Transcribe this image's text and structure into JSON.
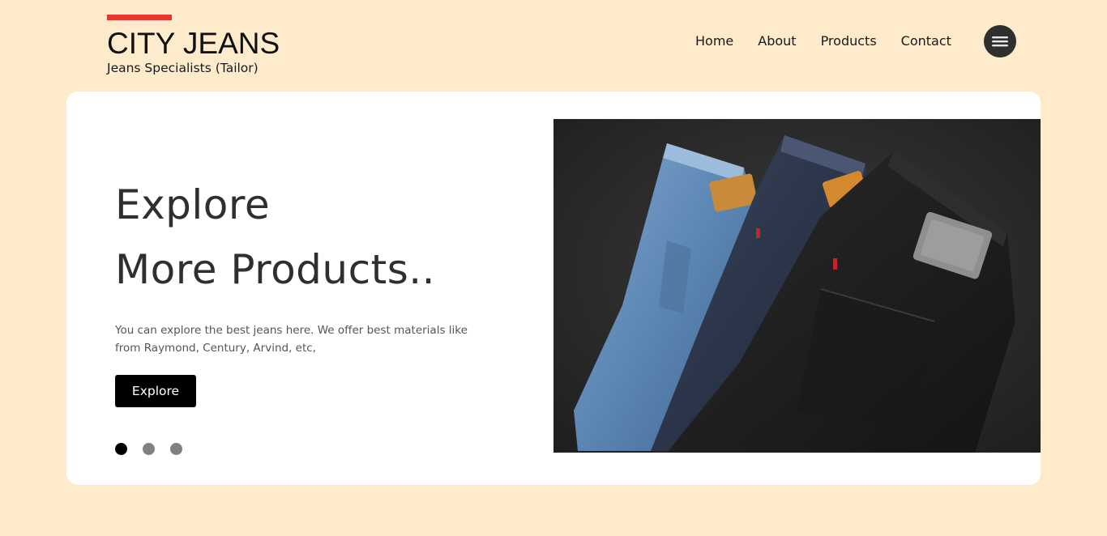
{
  "brand": {
    "title": "CITY JEANS",
    "subtitle": "Jeans Specialists (Tailor)",
    "accent_color": "#e8372e"
  },
  "nav": {
    "items": [
      {
        "label": "Home"
      },
      {
        "label": "About"
      },
      {
        "label": "Products"
      },
      {
        "label": "Contact"
      }
    ],
    "menu_icon": "hamburger-icon"
  },
  "hero": {
    "headline_line1": "Explore",
    "headline_line2": "More Products..",
    "description": "You can explore the best jeans here. We offer best materials like from Raymond, Century, Arvind, etc,",
    "button_label": "Explore",
    "slides": [
      {
        "active": true
      },
      {
        "active": false
      },
      {
        "active": false
      }
    ],
    "image_subject": "three pairs of folded jeans (light blue, dark blue, black) on dark background"
  },
  "colors": {
    "background": "#fdebcb",
    "card": "#ffffff",
    "button": "#000000",
    "dot_active": "#000000",
    "dot_inactive": "#808080"
  }
}
